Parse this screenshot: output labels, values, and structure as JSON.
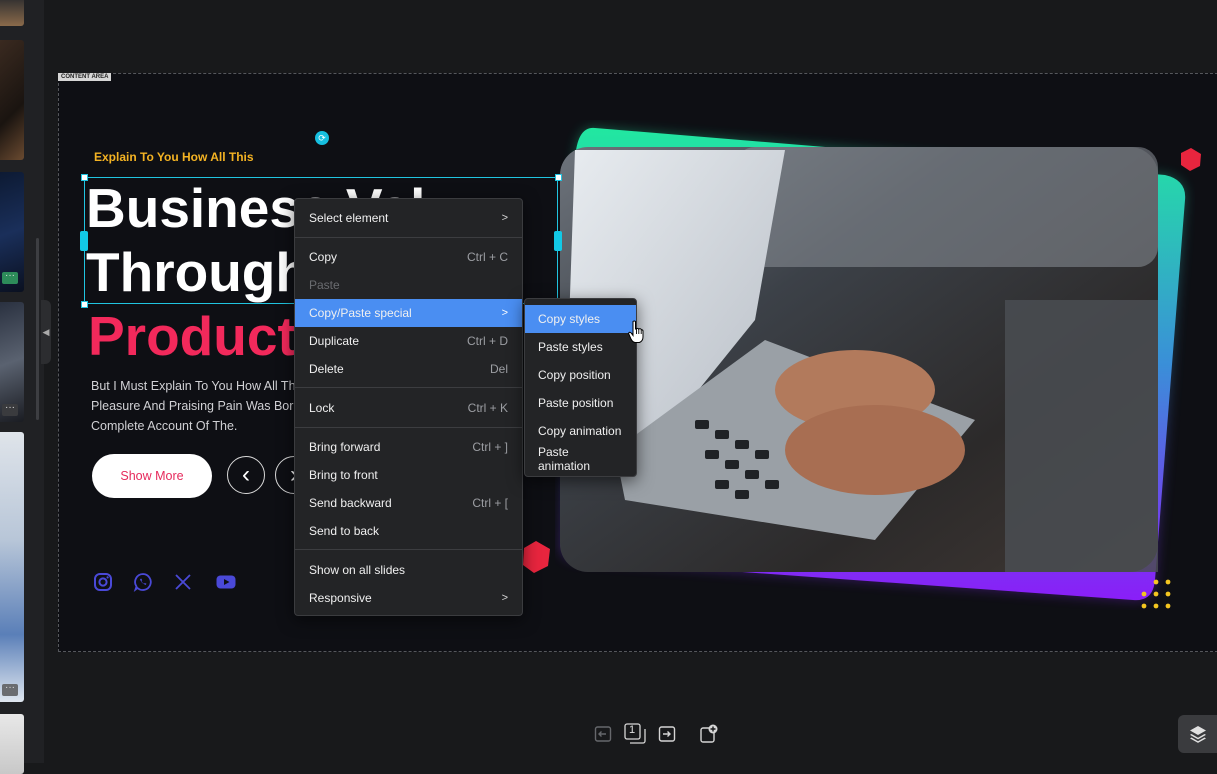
{
  "canvas": {
    "content_area_tag": "CONTENT AREA"
  },
  "slide": {
    "kicker": "Explain To You How All This",
    "headline_line1": "Business Val",
    "headline_line2": "Through",
    "headline_line3": "Product",
    "body": "But I Must Explain To You How All Th Pleasure And Praising Pain Was Bor Complete Account Of The.",
    "show_more": "Show More",
    "prev_arrow": "‹",
    "next_arrow": "›",
    "social_icons": [
      "instagram-icon",
      "whatsapp-icon",
      "x-icon",
      "youtube-icon"
    ]
  },
  "context_menu": {
    "items": [
      {
        "label": "Select element",
        "shortcut": "",
        "submenu": true
      },
      {
        "label": "Copy",
        "shortcut": "Ctrl + C"
      },
      {
        "label": "Paste",
        "shortcut": "",
        "disabled": true
      },
      {
        "label": "Copy/Paste special",
        "shortcut": "",
        "submenu": true,
        "active": true
      },
      {
        "label": "Duplicate",
        "shortcut": "Ctrl + D"
      },
      {
        "label": "Delete",
        "shortcut": "Del"
      },
      {
        "label": "Lock",
        "shortcut": "Ctrl + K"
      },
      {
        "label": "Bring forward",
        "shortcut": "Ctrl + ]"
      },
      {
        "label": "Bring to front",
        "shortcut": ""
      },
      {
        "label": "Send backward",
        "shortcut": "Ctrl + ["
      },
      {
        "label": "Send to back",
        "shortcut": ""
      },
      {
        "label": "Show on all slides",
        "shortcut": ""
      },
      {
        "label": "Responsive",
        "shortcut": "",
        "submenu": true
      }
    ]
  },
  "submenu": {
    "items": [
      "Copy styles",
      "Paste styles",
      "Copy position",
      "Paste position",
      "Copy animation",
      "Paste animation"
    ],
    "active_index": 0
  },
  "bottom_toolbar": {
    "page_number": "1"
  },
  "colors": {
    "accent_blue": "#4a8ef2",
    "selection_cyan": "#20c4e0",
    "kicker_yellow": "#f4b323",
    "headline_pink": "#f2295b",
    "social_purple": "#4a49d8"
  }
}
